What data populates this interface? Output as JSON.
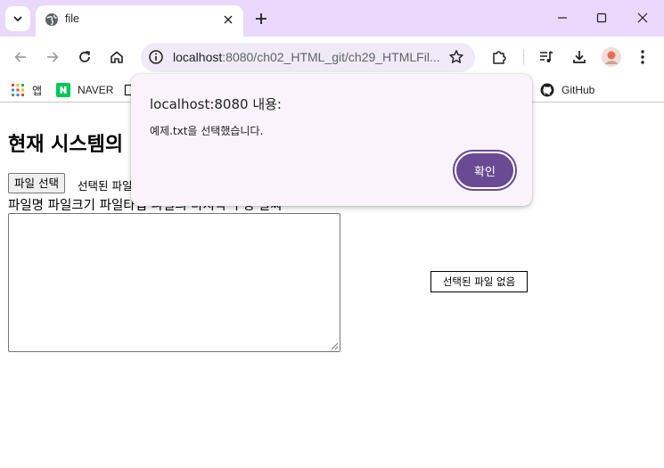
{
  "browser": {
    "tab_title": "file",
    "url_host": "localhost",
    "url_path": ":8080/ch02_HTML_git/ch29_HTMLFil...",
    "icons": {
      "tab_search": "chevron-down-icon",
      "favicon": "globe-icon",
      "tab_close": "close-icon",
      "new_tab": "plus-icon",
      "minimize": "minimize-icon",
      "maximize": "maximize-icon",
      "close_window": "close-window-icon",
      "back": "back-arrow-icon",
      "forward": "forward-arrow-icon",
      "reload": "reload-icon",
      "home": "home-icon",
      "site_info": "info-icon",
      "bookmark": "star-icon",
      "extensions": "puzzle-icon",
      "media": "media-control-icon",
      "downloads": "download-icon",
      "menu": "kebab-menu-icon"
    },
    "bookmarks": [
      {
        "label": "앱",
        "icon": "apps-grid-icon"
      },
      {
        "label": "NAVER",
        "icon": "naver-icon"
      },
      {
        "label": "GitHub",
        "icon": "github-icon"
      }
    ],
    "accent_color": "#e9d8fb"
  },
  "page": {
    "heading": "현재 시스템의",
    "file_button": "파일 선택",
    "file_status_partial": "선택된 파일",
    "column_labels": "파일명 파일크기 파일타입 파일의 마지막 수정 날짜",
    "file_status_box": "선택된 파일 없음"
  },
  "dialog": {
    "title": "localhost:8080 내용:",
    "message": "예제.txt을 선택했습니다.",
    "ok_label": "확인",
    "ok_color": "#6a4a93"
  }
}
